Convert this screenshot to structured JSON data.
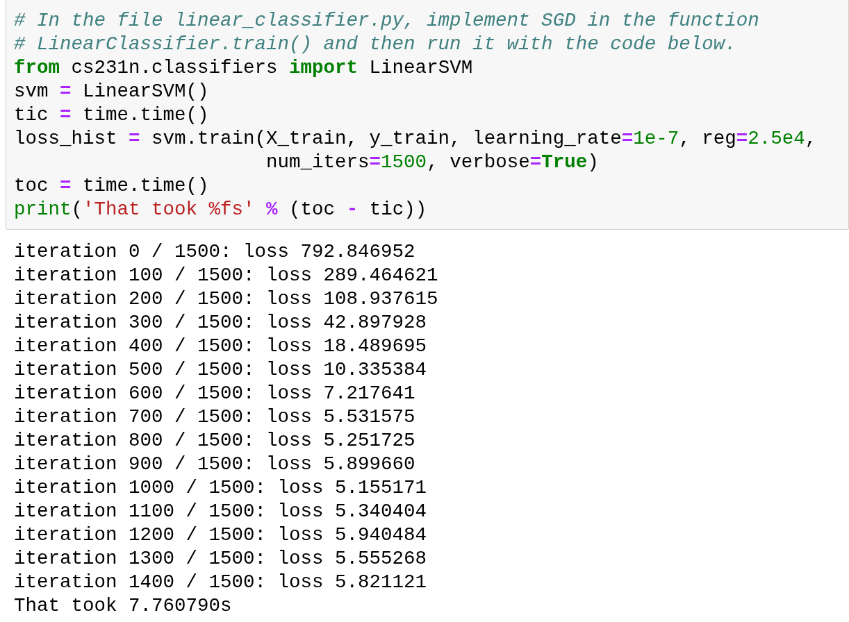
{
  "code_cell": {
    "lines": [
      [
        {
          "kind": "comment",
          "text": "# In the file linear_classifier.py, implement SGD in the function"
        }
      ],
      [
        {
          "kind": "comment",
          "text": "# LinearClassifier.train() and then run it with the code below."
        }
      ],
      [
        {
          "kind": "keyword",
          "text": "from"
        },
        {
          "kind": "plain",
          "text": " cs231n.classifiers "
        },
        {
          "kind": "keyword",
          "text": "import"
        },
        {
          "kind": "plain",
          "text": " LinearSVM"
        }
      ],
      [
        {
          "kind": "plain",
          "text": "svm "
        },
        {
          "kind": "operator",
          "text": "="
        },
        {
          "kind": "plain",
          "text": " LinearSVM()"
        }
      ],
      [
        {
          "kind": "plain",
          "text": "tic "
        },
        {
          "kind": "operator",
          "text": "="
        },
        {
          "kind": "plain",
          "text": " time.time()"
        }
      ],
      [
        {
          "kind": "plain",
          "text": "loss_hist "
        },
        {
          "kind": "operator",
          "text": "="
        },
        {
          "kind": "plain",
          "text": " svm.train(X_train, y_train, learning_rate"
        },
        {
          "kind": "operator",
          "text": "="
        },
        {
          "kind": "number",
          "text": "1e-7"
        },
        {
          "kind": "plain",
          "text": ", reg"
        },
        {
          "kind": "operator",
          "text": "="
        },
        {
          "kind": "number",
          "text": "2.5e4"
        },
        {
          "kind": "plain",
          "text": ","
        }
      ],
      [
        {
          "kind": "plain",
          "text": "                      num_iters"
        },
        {
          "kind": "operator",
          "text": "="
        },
        {
          "kind": "number",
          "text": "1500"
        },
        {
          "kind": "plain",
          "text": ", verbose"
        },
        {
          "kind": "operator",
          "text": "="
        },
        {
          "kind": "keyword",
          "text": "True"
        },
        {
          "kind": "plain",
          "text": ")"
        }
      ],
      [
        {
          "kind": "plain",
          "text": "toc "
        },
        {
          "kind": "operator",
          "text": "="
        },
        {
          "kind": "plain",
          "text": " time.time()"
        }
      ],
      [
        {
          "kind": "builtin",
          "text": "print"
        },
        {
          "kind": "plain",
          "text": "("
        },
        {
          "kind": "string",
          "text": "'That took %fs'"
        },
        {
          "kind": "operator",
          "text": " %"
        },
        {
          "kind": "plain",
          "text": " (toc "
        },
        {
          "kind": "operator",
          "text": "-"
        },
        {
          "kind": "plain",
          "text": " tic))"
        }
      ]
    ]
  },
  "output": [
    "iteration 0 / 1500: loss 792.846952",
    "iteration 100 / 1500: loss 289.464621",
    "iteration 200 / 1500: loss 108.937615",
    "iteration 300 / 1500: loss 42.897928",
    "iteration 400 / 1500: loss 18.489695",
    "iteration 500 / 1500: loss 10.335384",
    "iteration 600 / 1500: loss 7.217641",
    "iteration 700 / 1500: loss 5.531575",
    "iteration 800 / 1500: loss 5.251725",
    "iteration 900 / 1500: loss 5.899660",
    "iteration 1000 / 1500: loss 5.155171",
    "iteration 1100 / 1500: loss 5.340404",
    "iteration 1200 / 1500: loss 5.940484",
    "iteration 1300 / 1500: loss 5.555268",
    "iteration 1400 / 1500: loss 5.821121",
    "That took 7.760790s"
  ]
}
